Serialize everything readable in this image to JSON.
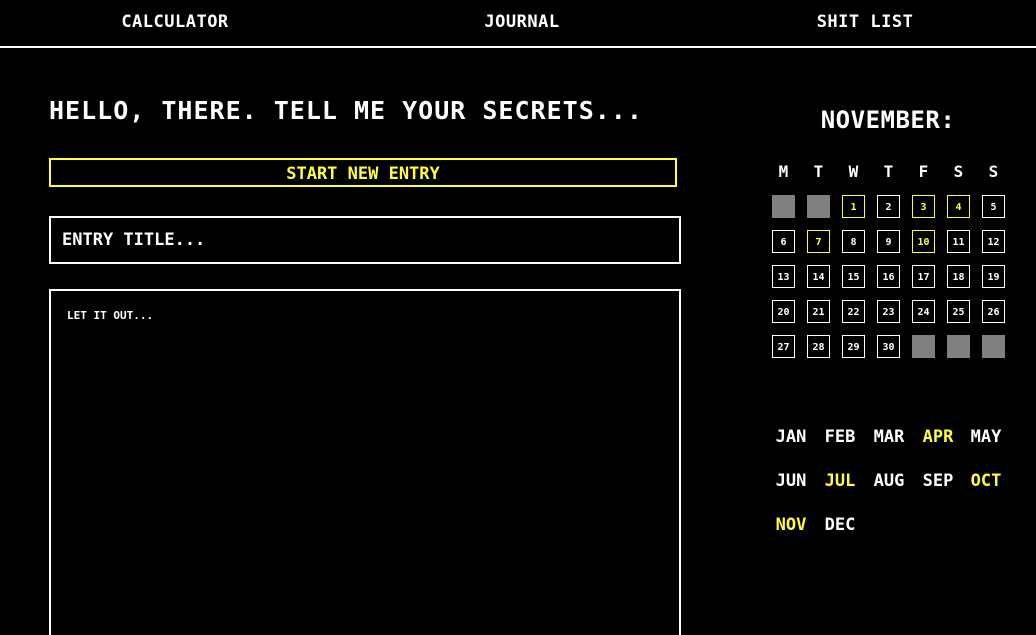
{
  "nav": {
    "items": [
      "CALCULATOR",
      "JOURNAL",
      "SHIT LIST"
    ]
  },
  "journal": {
    "heading": "HELLO, THERE. TELL ME YOUR SECRETS...",
    "new_entry_label": "START NEW ENTRY",
    "title_placeholder": "ENTRY TITLE...",
    "body_placeholder": "LET IT OUT..."
  },
  "calendar": {
    "title": "NOVEMBER:",
    "weekdays": [
      "M",
      "T",
      "W",
      "T",
      "F",
      "S",
      "S"
    ],
    "leading_blanks": 2,
    "trailing_blanks": 3,
    "days": [
      "1",
      "2",
      "3",
      "4",
      "5",
      "6",
      "7",
      "8",
      "9",
      "10",
      "11",
      "12",
      "13",
      "14",
      "15",
      "16",
      "17",
      "18",
      "19",
      "20",
      "21",
      "22",
      "23",
      "24",
      "25",
      "26",
      "27",
      "28",
      "29",
      "30"
    ],
    "highlighted_days": [
      "1",
      "3",
      "4",
      "7",
      "10"
    ]
  },
  "months": {
    "items": [
      "JAN",
      "FEB",
      "MAR",
      "APR",
      "MAY",
      "JUN",
      "JUL",
      "AUG",
      "SEP",
      "OCT",
      "NOV",
      "DEC"
    ],
    "highlighted": [
      "APR",
      "JUL",
      "OCT",
      "NOV"
    ]
  },
  "colors": {
    "background": "#000000",
    "foreground": "#ffffff",
    "accent": "#ffff33",
    "empty_cell": "#808080"
  }
}
